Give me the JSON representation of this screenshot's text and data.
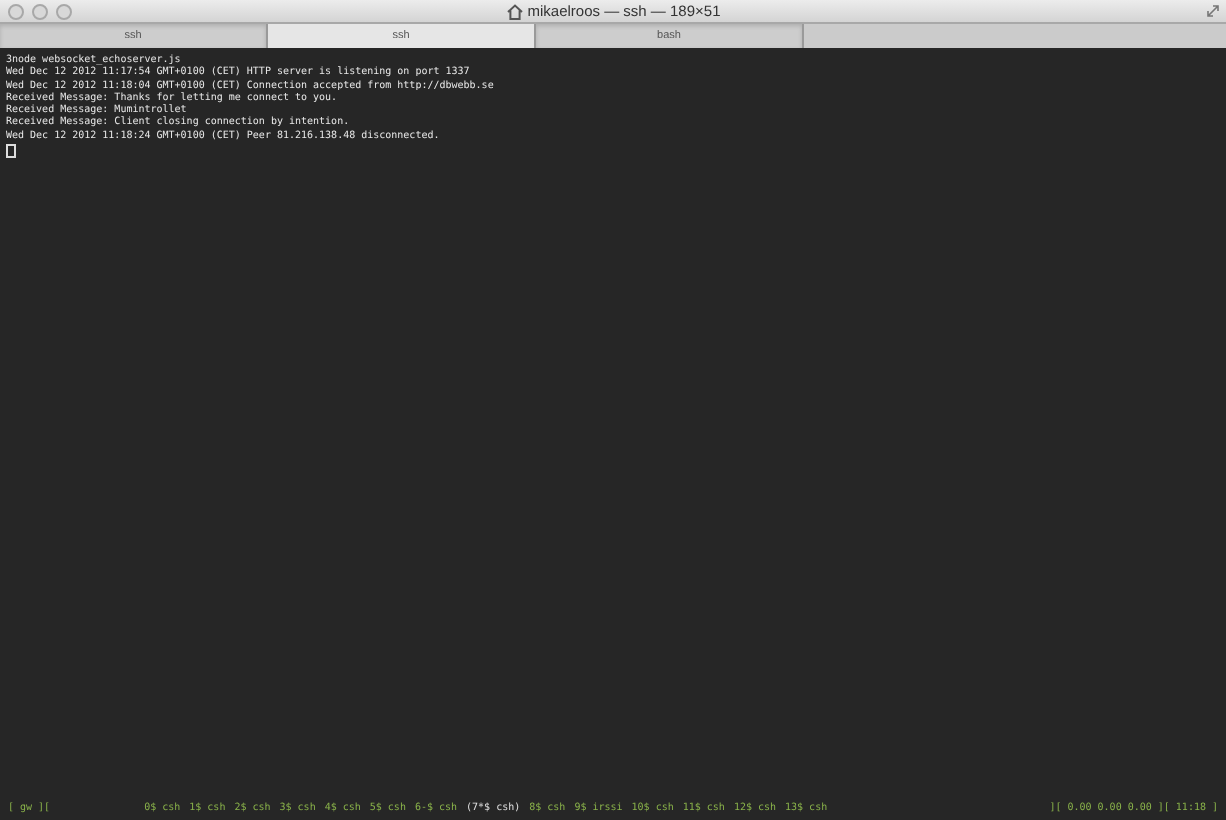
{
  "window": {
    "title": "mikaelroos — ssh — 189×51"
  },
  "tabs": [
    {
      "label": "ssh",
      "selected": false
    },
    {
      "label": "ssh",
      "selected": true
    },
    {
      "label": "bash",
      "selected": false
    }
  ],
  "terminal": {
    "lines": [
      "3node websocket_echoserver.js",
      "Wed Dec 12 2012 11:17:54 GMT+0100 (CET) HTTP server is listening on port 1337",
      "Wed Dec 12 2012 11:18:04 GMT+0100 (CET) Connection accepted from http://dbwebb.se",
      "Received Message: Thanks for letting me connect to you.",
      "Received Message: Mumintrollet",
      "Received Message: Client closing connection by intention.",
      "Wed Dec 12 2012 11:18:24 GMT+0100 (CET) Peer 81.216.138.48 disconnected."
    ]
  },
  "status_bar": {
    "host": "[ gw ][",
    "windows": [
      {
        "label": "0$ csh",
        "selected": false
      },
      {
        "label": "1$ csh",
        "selected": false
      },
      {
        "label": "2$ csh",
        "selected": false
      },
      {
        "label": "3$ csh",
        "selected": false
      },
      {
        "label": "4$ csh",
        "selected": false
      },
      {
        "label": "5$ csh",
        "selected": false
      },
      {
        "label": "6-$ csh",
        "selected": false
      },
      {
        "label": "(7*$ csh)",
        "selected": true
      },
      {
        "label": "8$ csh",
        "selected": false
      },
      {
        "label": "9$ irssi",
        "selected": false
      },
      {
        "label": "10$ csh",
        "selected": false
      },
      {
        "label": "11$ csh",
        "selected": false
      },
      {
        "label": "12$ csh",
        "selected": false
      },
      {
        "label": "13$ csh",
        "selected": false
      }
    ],
    "load": "][ 0.00 0.00 0.00 ][",
    "clock": "11:18 ]"
  }
}
